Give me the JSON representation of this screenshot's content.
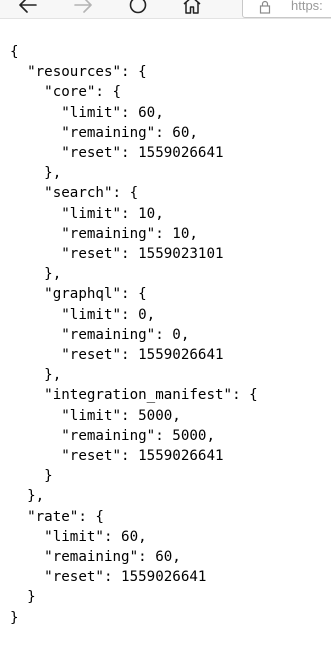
{
  "toolbar": {
    "back_icon": "arrow-left-icon",
    "forward_icon": "arrow-right-icon",
    "refresh_icon": "refresh-icon",
    "home_icon": "home-icon",
    "lock_icon": "lock-icon",
    "address_text": "https:",
    "forward_disabled": true
  },
  "json_lines": [
    "{",
    "  \"resources\": {",
    "    \"core\": {",
    "      \"limit\": 60,",
    "      \"remaining\": 60,",
    "      \"reset\": 1559026641",
    "    },",
    "    \"search\": {",
    "      \"limit\": 10,",
    "      \"remaining\": 10,",
    "      \"reset\": 1559023101",
    "    },",
    "    \"graphql\": {",
    "      \"limit\": 0,",
    "      \"remaining\": 0,",
    "      \"reset\": 1559026641",
    "    },",
    "    \"integration_manifest\": {",
    "      \"limit\": 5000,",
    "      \"remaining\": 5000,",
    "      \"reset\": 1559026641",
    "    }",
    "  },",
    "  \"rate\": {",
    "    \"limit\": 60,",
    "    \"remaining\": 60,",
    "    \"reset\": 1559026641",
    "  }",
    "}"
  ]
}
